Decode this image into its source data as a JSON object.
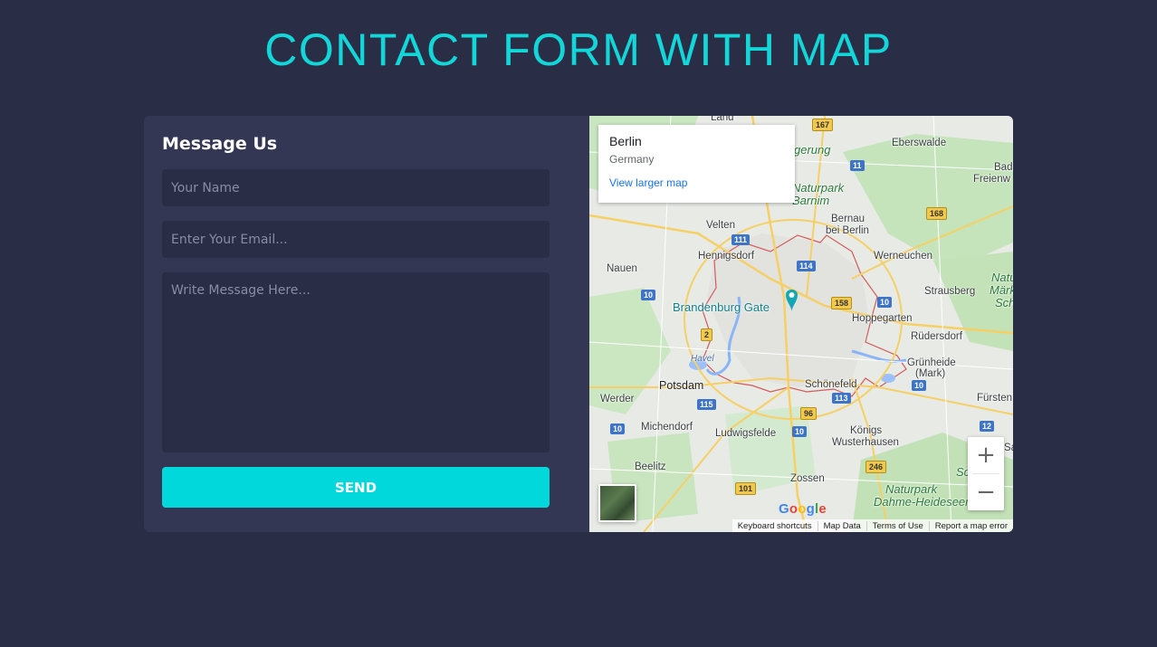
{
  "page": {
    "title": "CONTACT FORM WITH MAP"
  },
  "colors": {
    "background": "#2a2d46",
    "card": "#343754",
    "accent": "#00d8dc"
  },
  "form": {
    "title": "Message Us",
    "name_placeholder": "Your Name",
    "email_placeholder": "Enter Your Email...",
    "message_placeholder": "Write Message Here...",
    "send_label": "SEND"
  },
  "map": {
    "info": {
      "city": "Berlin",
      "country": "Germany",
      "link": "View larger map"
    },
    "labels": {
      "land": "Land",
      "eberswalde": "Eberswalde",
      "bad": "Bad",
      "freienw": "Freienw",
      "gerung": "gerung",
      "naturpark_barnim_1": "Naturpark",
      "naturpark_barnim_2": "Barnim",
      "bernau_1": "Bernau",
      "bernau_2": "bei Berlin",
      "velten": "Velten",
      "hennigsdorf": "Hennigsdorf",
      "werneuchen": "Werneuchen",
      "nauen": "Nauen",
      "strausberg": "Strausberg",
      "natu": "Natu",
      "mar": "Märk",
      "sch": "Sch",
      "brandenburg_gate": "Brandenburg Gate",
      "hoppegarten": "Hoppegarten",
      "rudersdorf": "Rüdersdorf",
      "grunheide_1": "Grünheide",
      "grunheide_2": "(Mark)",
      "havel": "Havel",
      "potsdam": "Potsdam",
      "schonefeld": "Schönefeld",
      "werder": "Werder",
      "fursten": "Fürsten",
      "michendorf": "Michendorf",
      "ludwigsfelde": "Ludwigsfelde",
      "konigs_1": "Königs",
      "konigs_2": "Wusterhausen",
      "beelitz": "Beelitz",
      "zossen": "Zossen",
      "naturpark_dahme_1": "Naturpark",
      "naturpark_dahme_2": "Dahme-Heideseen",
      "sa": "Sa",
      "sc": "Sc"
    },
    "shields": {
      "r167": "167",
      "r11a": "11",
      "r168": "168",
      "r111": "111",
      "r114": "114",
      "r10a": "10",
      "r158": "158",
      "r10b": "10",
      "r2": "2",
      "r10c": "10",
      "r115": "115",
      "r113": "113",
      "r96": "96",
      "r10d": "10",
      "r10e": "10",
      "r12": "12",
      "r246": "246",
      "r101": "101"
    },
    "zoom_in": "+",
    "zoom_out": "−",
    "google": [
      "G",
      "o",
      "o",
      "g",
      "l",
      "e"
    ],
    "attribution": {
      "shortcuts": "Keyboard shortcuts",
      "data": "Map Data",
      "terms": "Terms of Use",
      "report": "Report a map error"
    }
  }
}
